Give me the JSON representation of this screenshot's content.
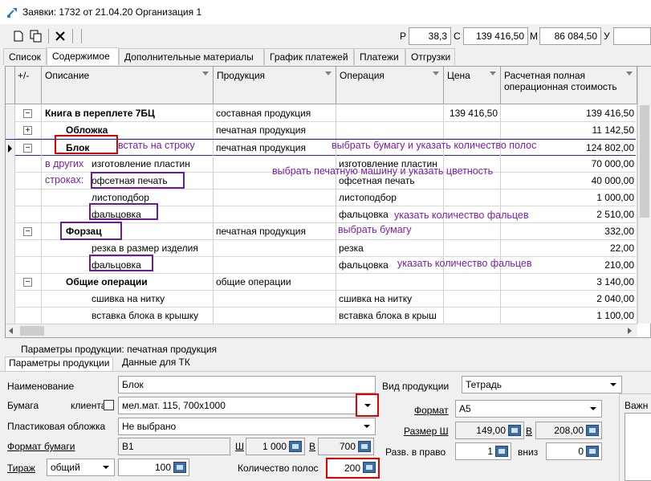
{
  "window": {
    "title": "Заявки: 1732 от 21.04.20  Организация 1"
  },
  "toolbar": {
    "r_label": "Р",
    "r_value": "38,3",
    "c_label": "С",
    "c_value": "139 416,50",
    "m_label": "М",
    "m_value": "86 084,50",
    "u_label": "У"
  },
  "tabs": [
    "Список",
    "Содержимое",
    "Дополнительные материалы",
    "График платежей",
    "Платежи",
    "Отгрузки"
  ],
  "grid": {
    "headers": {
      "plusminus": "+/-",
      "description": "Описание",
      "product": "Продукция",
      "operation": "Операция",
      "price": "Цена",
      "cost": "Расчетная полная операционная стоимость"
    },
    "rows": [
      {
        "toggle": "−",
        "desc": "Книга в переплете 7БЦ",
        "product": "составная продукция",
        "operation": "",
        "price": "139 416,50",
        "cost": "139 416,50"
      },
      {
        "toggle": "+",
        "desc": "Обложка",
        "product": "печатная продукция",
        "operation": "",
        "price": "",
        "cost": "11 142,50"
      },
      {
        "toggle": "−",
        "desc": "Блок",
        "product": "печатная продукция",
        "operation": "",
        "price": "",
        "cost": "124 802,00"
      },
      {
        "toggle": "",
        "desc": "изготовление пластин",
        "product": "",
        "operation": "изготовление пластин",
        "price": "",
        "cost": "70 000,00"
      },
      {
        "toggle": "",
        "desc": "офсетная печать",
        "product": "",
        "operation": "офсетная печать",
        "price": "",
        "cost": "40 000,00"
      },
      {
        "toggle": "",
        "desc": "листоподбор",
        "product": "",
        "operation": "листоподбор",
        "price": "",
        "cost": "1 000,00"
      },
      {
        "toggle": "",
        "desc": "фальцовка",
        "product": "",
        "operation": "фальцовка",
        "price": "",
        "cost": "2 510,00"
      },
      {
        "toggle": "−",
        "desc": "Форзац",
        "product": "печатная продукция",
        "operation": "",
        "price": "",
        "cost": "332,00"
      },
      {
        "toggle": "",
        "desc": "резка в размер изделия",
        "product": "",
        "operation": "резка",
        "price": "",
        "cost": "22,00"
      },
      {
        "toggle": "",
        "desc": "фальцовка",
        "product": "",
        "operation": "фальцовка",
        "price": "",
        "cost": "210,00"
      },
      {
        "toggle": "−",
        "desc": "Общие операции",
        "product": "общие операции",
        "operation": "",
        "price": "",
        "cost": "3 140,00"
      },
      {
        "toggle": "",
        "desc": "сшивка на нитку",
        "product": "",
        "operation": "сшивка на нитку",
        "price": "",
        "cost": "2 040,00"
      },
      {
        "toggle": "",
        "desc": "вставка блока в крышку",
        "product": "",
        "operation": "вставка блока в крыш",
        "price": "",
        "cost": "1 100,00"
      }
    ]
  },
  "annotations": {
    "a1": "встать на строку",
    "a2": "выбрать бумагу и указать количество полос",
    "a3": "в других",
    "a4": "строках:",
    "a5": "выбрать печатную машину и указать цветность",
    "a6": "указать количество фальцев",
    "a7": "выбрать бумагу",
    "a8": "указать количество фальцев"
  },
  "params": {
    "caption": "Параметры продукции: печатная продукция",
    "tabs": [
      "Параметры продукции",
      "Данные для ТК"
    ],
    "name_label": "Наименование",
    "name_value": "Блок",
    "paper_label": "Бумага",
    "client_label": "клиента",
    "paper_value": "мел.мат. 115, 700x1000",
    "plastic_label": "Пластиковая обложка",
    "plastic_value": "Не выбрано",
    "paper_format_label": "Формат бумаги",
    "paper_format_value": "B1",
    "w_label": "Ш",
    "w_value": "1 000",
    "h_label": "В",
    "h_value": "700",
    "run_label": "Тираж",
    "run_type": "общий",
    "run_value": "100",
    "pages_label": "Количество полос",
    "pages_value": "200",
    "product_kind_label": "Вид продукции",
    "product_kind_value": "Тетрадь",
    "format_label": "Формат",
    "format_value": "А5",
    "size_label": "Размер Ш",
    "size_w": "149,00",
    "size_b_label": "В",
    "size_h": "208,00",
    "spread_label": "Разв. в право",
    "spread_right": "1",
    "down_label": "вниз",
    "spread_down": "0",
    "important_label": "Важн"
  }
}
